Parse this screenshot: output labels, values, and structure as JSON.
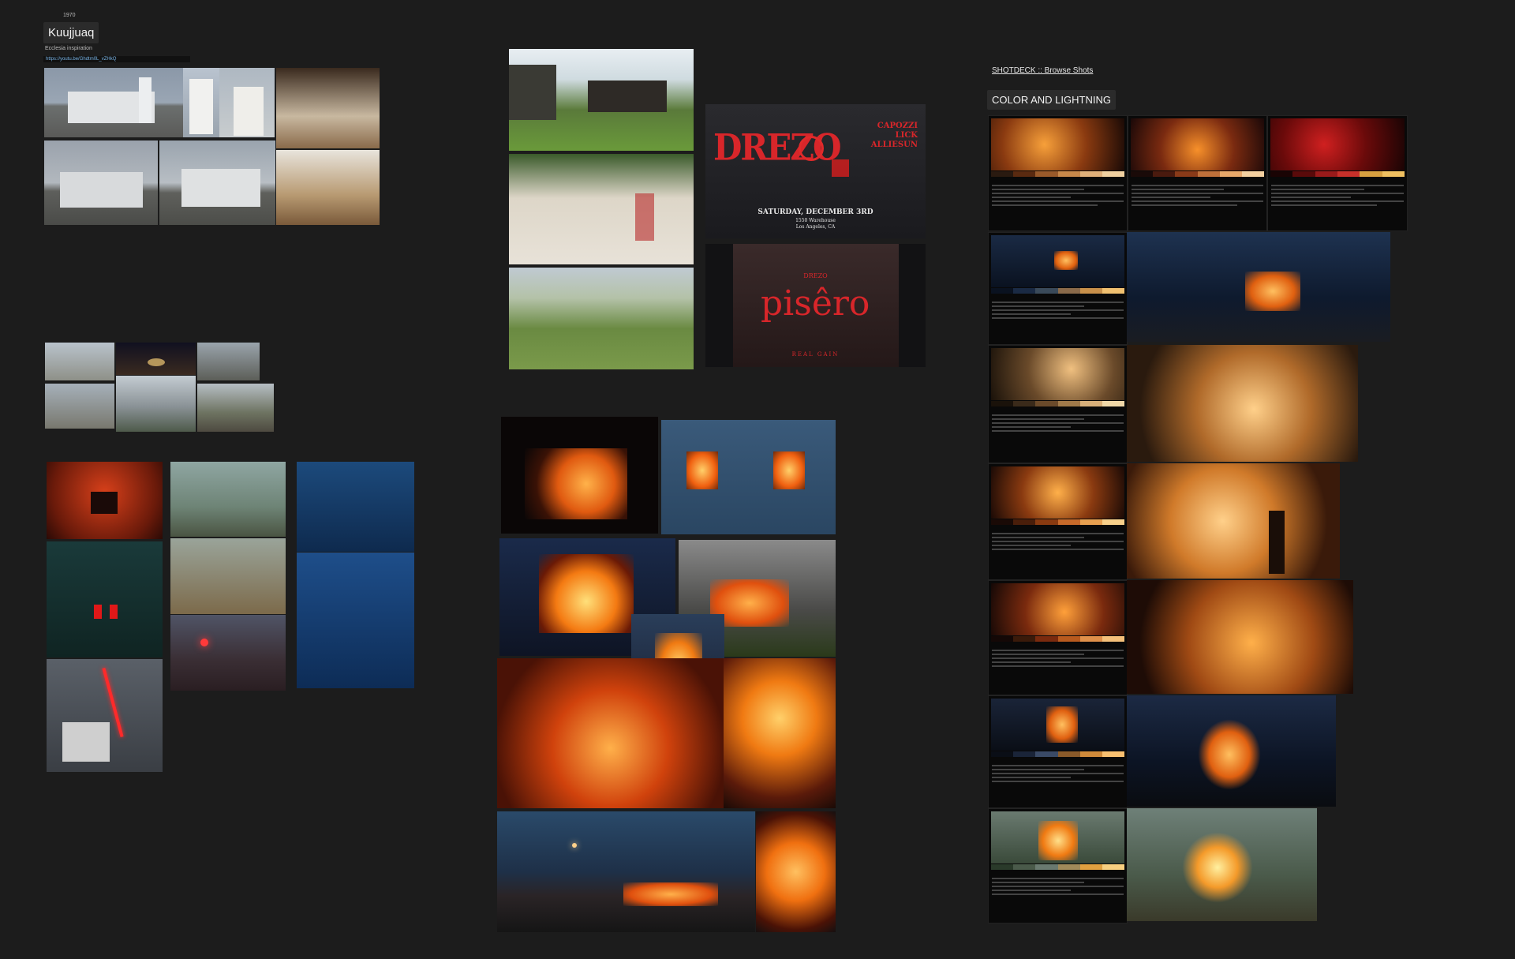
{
  "board": {
    "small_caption": "1970",
    "title": "Kuujjuaq",
    "subtitle": "Ecclesia inspiration",
    "url": "https://youtu.be/Ghdtm0L_vZHkQ"
  },
  "shotdeck": {
    "link_label": "SHOTDECK :: Browse Shots",
    "section_label": "COLOR AND LIGHTNING"
  },
  "poster_drezo": {
    "title": "DREZO",
    "lineup": [
      "CAPOZZI",
      "LICK",
      "ALLIESUN"
    ],
    "date": "SATURDAY, DECEMBER 3RD",
    "venue": "1550 Warehouse",
    "city": "Los Angeles, CA"
  },
  "poster_pisero": {
    "small_title": "DREZO",
    "title": "pisêro",
    "footer": "REAL GAIN"
  },
  "colors": {
    "background": "#1c1c1c",
    "fire": "#f07a1a",
    "accent_red": "#d8262a"
  }
}
